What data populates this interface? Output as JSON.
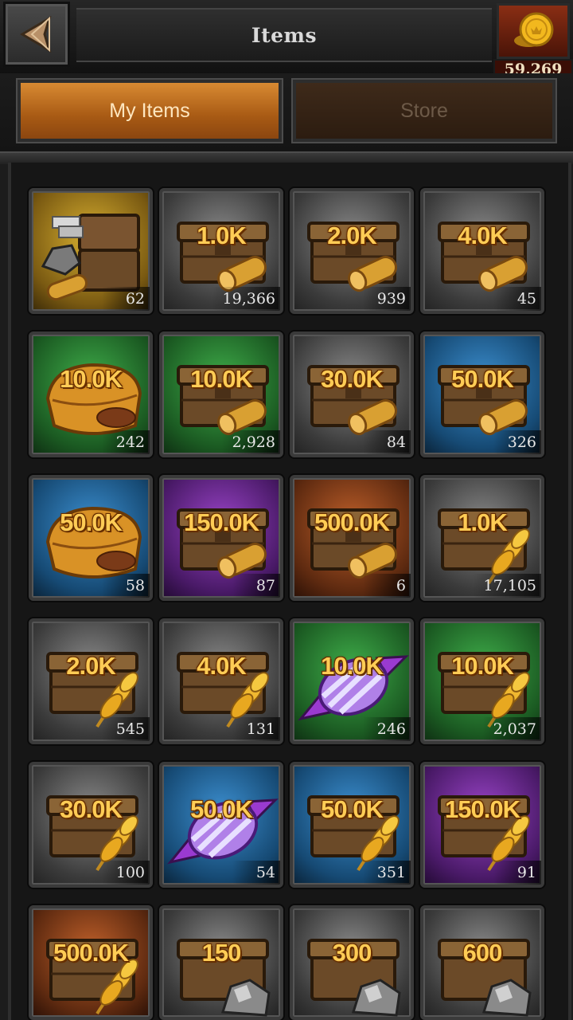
{
  "header": {
    "title": "Items",
    "gold": "59,269"
  },
  "tabs": [
    {
      "label": "My Items",
      "active": true
    },
    {
      "label": "Store",
      "active": false
    }
  ],
  "colors": {
    "tab_active": "#c9782a",
    "tab_inactive": "#33231a",
    "amount_text": "#ffcc55",
    "gold_box": "#7a2410"
  },
  "items": [
    {
      "amount": "",
      "count": "62",
      "bg": "gold",
      "icon": "resource-bundle-icon"
    },
    {
      "amount": "1.0K",
      "count": "19,366",
      "bg": "gray",
      "icon": "wood-chest-icon"
    },
    {
      "amount": "2.0K",
      "count": "939",
      "bg": "gray",
      "icon": "wood-chest-icon"
    },
    {
      "amount": "4.0K",
      "count": "45",
      "bg": "gray",
      "icon": "wood-chest-icon"
    },
    {
      "amount": "10.0K",
      "count": "242",
      "bg": "green",
      "icon": "bread-icon"
    },
    {
      "amount": "10.0K",
      "count": "2,928",
      "bg": "green",
      "icon": "wood-chest-icon"
    },
    {
      "amount": "30.0K",
      "count": "84",
      "bg": "gray",
      "icon": "wood-chest-icon"
    },
    {
      "amount": "50.0K",
      "count": "326",
      "bg": "blue",
      "icon": "wood-chest-icon"
    },
    {
      "amount": "50.0K",
      "count": "58",
      "bg": "blue",
      "icon": "bread-icon"
    },
    {
      "amount": "150.0K",
      "count": "87",
      "bg": "purple",
      "icon": "wood-chest-icon"
    },
    {
      "amount": "500.0K",
      "count": "6",
      "bg": "orange",
      "icon": "wood-chest-icon"
    },
    {
      "amount": "1.0K",
      "count": "17,105",
      "bg": "gray",
      "icon": "wheat-chest-icon"
    },
    {
      "amount": "2.0K",
      "count": "545",
      "bg": "gray",
      "icon": "wheat-chest-icon"
    },
    {
      "amount": "4.0K",
      "count": "131",
      "bg": "gray",
      "icon": "wheat-chest-icon"
    },
    {
      "amount": "10.0K",
      "count": "246",
      "bg": "green",
      "icon": "candy-icon"
    },
    {
      "amount": "10.0K",
      "count": "2,037",
      "bg": "green",
      "icon": "wheat-chest-icon"
    },
    {
      "amount": "30.0K",
      "count": "100",
      "bg": "gray",
      "icon": "wheat-chest-icon"
    },
    {
      "amount": "50.0K",
      "count": "54",
      "bg": "blue",
      "icon": "candy-icon"
    },
    {
      "amount": "50.0K",
      "count": "351",
      "bg": "blue",
      "icon": "wheat-chest-icon"
    },
    {
      "amount": "150.0K",
      "count": "91",
      "bg": "purple",
      "icon": "wheat-chest-icon"
    },
    {
      "amount": "500.0K",
      "count": "",
      "bg": "orange",
      "icon": "wheat-chest-icon"
    },
    {
      "amount": "150",
      "count": "",
      "bg": "gray",
      "icon": "ore-chest-icon"
    },
    {
      "amount": "300",
      "count": "",
      "bg": "gray",
      "icon": "ore-chest-icon"
    },
    {
      "amount": "600",
      "count": "",
      "bg": "gray",
      "icon": "ore-chest-icon"
    }
  ]
}
